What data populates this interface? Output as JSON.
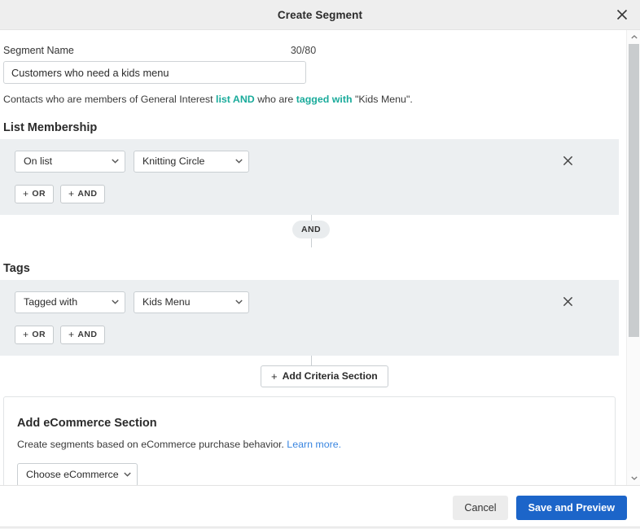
{
  "header": {
    "title": "Create Segment",
    "close_icon": "close-icon"
  },
  "segment_name": {
    "label": "Segment Name",
    "char_count": "30/80",
    "value": "Customers who need a kids menu",
    "placeholder": "Segment Name"
  },
  "summary": {
    "part1": "Contacts who are members of General Interest ",
    "kw1": "list AND",
    "part2": " who are ",
    "kw2": "tagged with",
    "part3": " \"Kids Menu\"."
  },
  "sections": [
    {
      "heading": "List Membership",
      "condition_value": "On list",
      "target_value": "Knitting Circle",
      "or_label": "OR",
      "and_label": "AND",
      "plus": "+",
      "remove_icon": "close-icon"
    },
    {
      "heading": "Tags",
      "condition_value": "Tagged with",
      "target_value": "Kids Menu",
      "or_label": "OR",
      "and_label": "AND",
      "plus": "+",
      "remove_icon": "close-icon"
    }
  ],
  "connector": {
    "label": "AND"
  },
  "add_criteria": {
    "plus": "+",
    "label": "Add Criteria Section"
  },
  "ecommerce": {
    "title": "Add eCommerce Section",
    "description": "Create segments based on eCommerce purchase behavior.",
    "link_label": "Learn more.",
    "select_value": "Choose eCommerce"
  },
  "footer": {
    "cancel_label": "Cancel",
    "save_label": "Save and Preview"
  },
  "colors": {
    "accent_blue": "#1c65c9",
    "keyword_teal": "#1aab9b",
    "link_blue": "#3a86e0",
    "section_bg": "#eceff1",
    "header_bg": "#eeeeee"
  }
}
